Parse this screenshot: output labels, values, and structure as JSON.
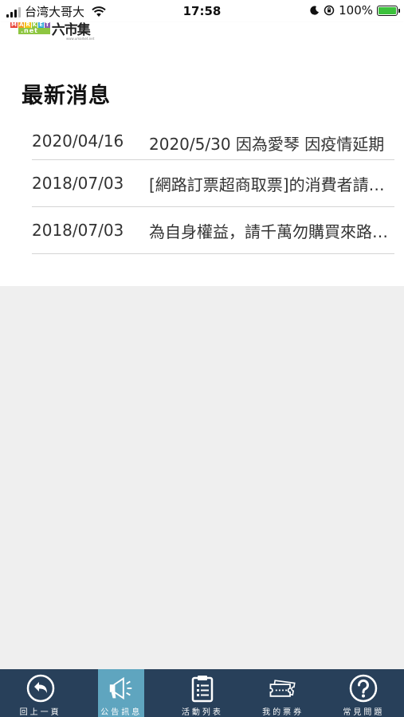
{
  "status_bar": {
    "carrier": "台湾大哥大",
    "time": "17:58",
    "battery": "100%"
  },
  "header": {
    "logo_en_top": [
      "M",
      "A",
      "R",
      "K",
      "E",
      "T"
    ],
    "logo_en_bottom": ".net",
    "logo_cn": "六市集",
    "logo_sub": "www.umarket.net"
  },
  "page": {
    "title": "最新消息"
  },
  "news": [
    {
      "date": "2020/04/16",
      "title": "2020/5/30 因為愛琴 因疫情延期"
    },
    {
      "date": "2018/07/03",
      "title": "[網路訂票超商取票]的消費者請注意"
    },
    {
      "date": "2018/07/03",
      "title": "為自身權益，請千萬勿購買來路不明票券"
    }
  ],
  "tabs": [
    {
      "label": "回上一頁",
      "icon": "back-arrow-icon",
      "active": false
    },
    {
      "label": "公告訊息",
      "icon": "megaphone-icon",
      "active": true
    },
    {
      "label": "活動列表",
      "icon": "clipboard-list-icon",
      "active": false
    },
    {
      "label": "我的票券",
      "icon": "ticket-icon",
      "active": false
    },
    {
      "label": "常見問題",
      "icon": "question-icon",
      "active": false
    }
  ],
  "colors": {
    "tab_bar": "#28405a",
    "tab_active": "#5fa5bf",
    "logo_green": "#8ec641"
  }
}
